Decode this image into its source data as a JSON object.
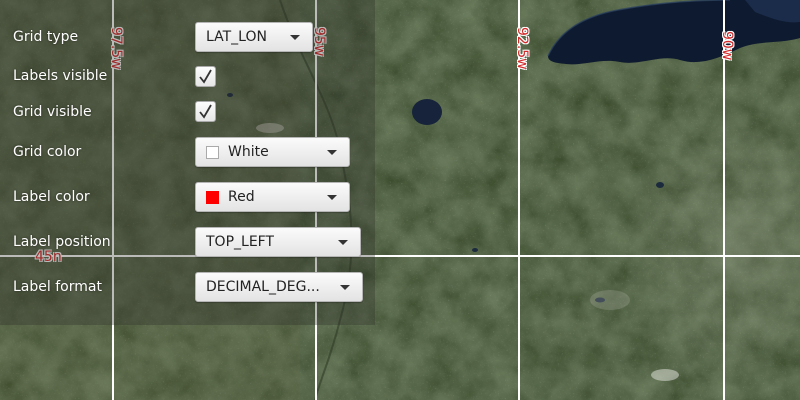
{
  "map": {
    "grid_lines": {
      "color": "#ffffff",
      "longitude_labels": [
        "97.5w",
        "95w",
        "92.5w",
        "90w"
      ],
      "latitude_labels": [
        "45n"
      ],
      "label_color": "#d32b2b"
    }
  },
  "controls": {
    "grid_type": {
      "label": "Grid type",
      "value": "LAT_LON"
    },
    "labels_visible": {
      "label": "Labels visible",
      "checked": true
    },
    "grid_visible": {
      "label": "Grid visible",
      "checked": true
    },
    "grid_color": {
      "label": "Grid color",
      "value": "White",
      "swatch": "#ffffff"
    },
    "label_color": {
      "label": "Label color",
      "value": "Red",
      "swatch": "#ff0000"
    },
    "label_position": {
      "label": "Label position",
      "value": "TOP_LEFT"
    },
    "label_format": {
      "label": "Label format",
      "value": "DECIMAL_DEG..."
    }
  }
}
